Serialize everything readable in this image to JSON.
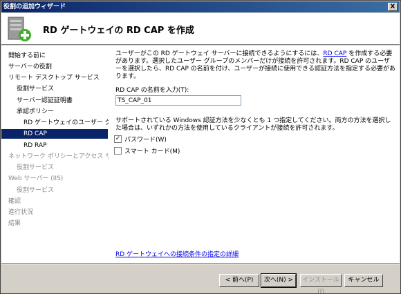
{
  "window": {
    "title": "役割の追加ウィザード",
    "close": "X"
  },
  "header": {
    "title": "RD ゲートウェイの RD CAP を作成"
  },
  "sidebar": {
    "items": [
      {
        "label": "開始する前に",
        "state": "normal"
      },
      {
        "label": "サーバーの役割",
        "state": "normal"
      },
      {
        "label": "リモート デスクトップ サービス",
        "state": "normal"
      },
      {
        "label": "役割サービス",
        "state": "normal"
      },
      {
        "label": "サーバー認証証明書",
        "state": "normal"
      },
      {
        "label": "承認ポリシー",
        "state": "normal"
      },
      {
        "label": "RD ゲートウェイのユーザー グ...",
        "state": "normal"
      },
      {
        "label": "RD CAP",
        "state": "selected"
      },
      {
        "label": "RD RAP",
        "state": "normal"
      },
      {
        "label": "ネットワーク ポリシーとアクセス サービ...",
        "state": "disabled"
      },
      {
        "label": "役割サービス",
        "state": "disabled"
      },
      {
        "label": "Web サーバー (IIS)",
        "state": "disabled"
      },
      {
        "label": "役割サービス",
        "state": "disabled"
      },
      {
        "label": "確認",
        "state": "disabled"
      },
      {
        "label": "進行状況",
        "state": "disabled"
      },
      {
        "label": "結果",
        "state": "disabled"
      }
    ]
  },
  "main": {
    "desc_before_link": "ユーザーがこの RD ゲートウェイ サーバーに接続できるようにするには、",
    "desc_link": "RD CAP",
    "desc_after_link": " を作成する必要があります。選択したユーザー グループのメンバーだけが接続を許可されます。RD CAP のユーザーを選択したら、RD CAP の名前を付け、ユーザーが接続に使用できる認証方法を指定する必要があります。",
    "name_label": "RD CAP の名前を入力(T):",
    "name_value": "TS_CAP_01",
    "auth_desc": "サポートされている Windows 認証方法を少なくとも 1 つ指定してください。両方の方法を選択した場合は、いずれかの方法を使用しているクライアントが接続を許可されます。",
    "password_label": "パスワード(W)",
    "password_checked": true,
    "smartcard_label": "スマート カード(M)",
    "smartcard_checked": false,
    "details_link": "RD ゲートウェイへの接続条件の指定の詳細"
  },
  "footer": {
    "back": "< 前へ(P)",
    "next": "次へ(N) >",
    "install": "インストール(I)",
    "cancel": "キャンセル"
  }
}
